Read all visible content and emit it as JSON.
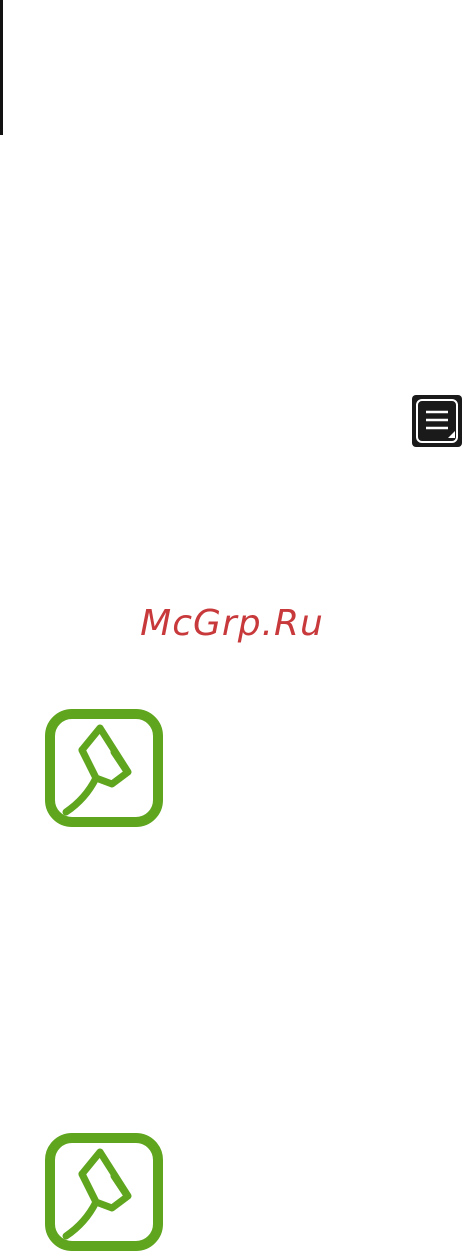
{
  "watermark": {
    "text": "McGrp.Ru"
  },
  "icons": {
    "menu_key": "menu-key-icon",
    "note": "note-pencil-icon"
  },
  "colors": {
    "note_green": "#5fa61e",
    "watermark_red": "#c8393b",
    "menu_key_bg": "#1a1a1a"
  }
}
